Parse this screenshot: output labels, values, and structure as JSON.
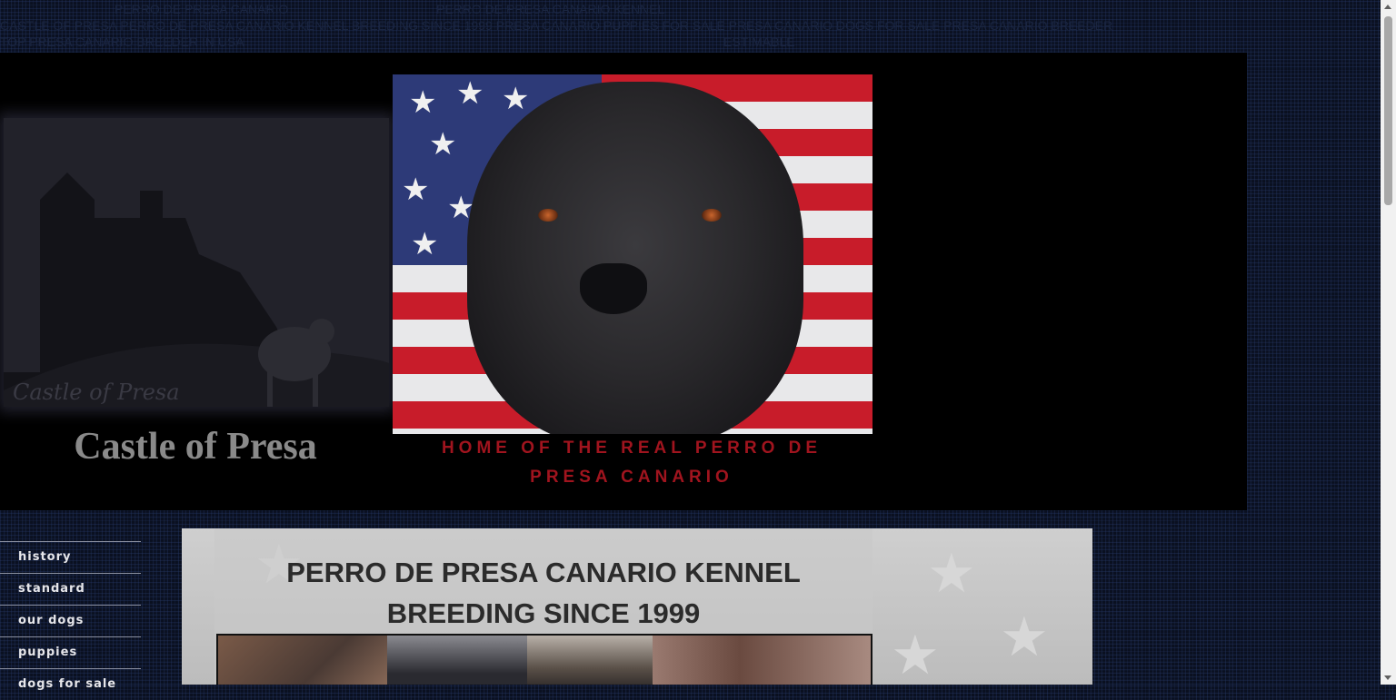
{
  "top_text": {
    "line1_left": "PERRO DE PRESA CANARIO",
    "line1_right": "PERRO DE PRESA CANARIO KENNEL",
    "line2": "CASTLE OF PRESA PERRO DE PRESA CANARIO KENNEL BREEDING SINCE 1999 PRESA CANARIO PUPPIES FOR SALE PRESA CANARIO DOGS FOR SALE PRESA CANARIO BREEDER",
    "line3_left": "TOP PRESA CANARIO BREEDER IN USA",
    "line3_right": "ESTIMABLE"
  },
  "header": {
    "banner_caption": "Castle of Presa",
    "site_title": "Castle of Presa",
    "tagline": "HOME OF THE REAL PERRO DE PRESA CANARIO"
  },
  "nav": {
    "items": [
      {
        "label": "history"
      },
      {
        "label": "standard"
      },
      {
        "label": "our dogs"
      },
      {
        "label": "puppies"
      },
      {
        "label": "dogs for sale"
      }
    ]
  },
  "content": {
    "title_line1": "PERRO DE PRESA CANARIO KENNEL",
    "title_line2": "BREEDING SINCE 1999"
  },
  "colors": {
    "tagline": "#a0141e",
    "page_background": "#0a1020",
    "header_background": "#000000"
  }
}
